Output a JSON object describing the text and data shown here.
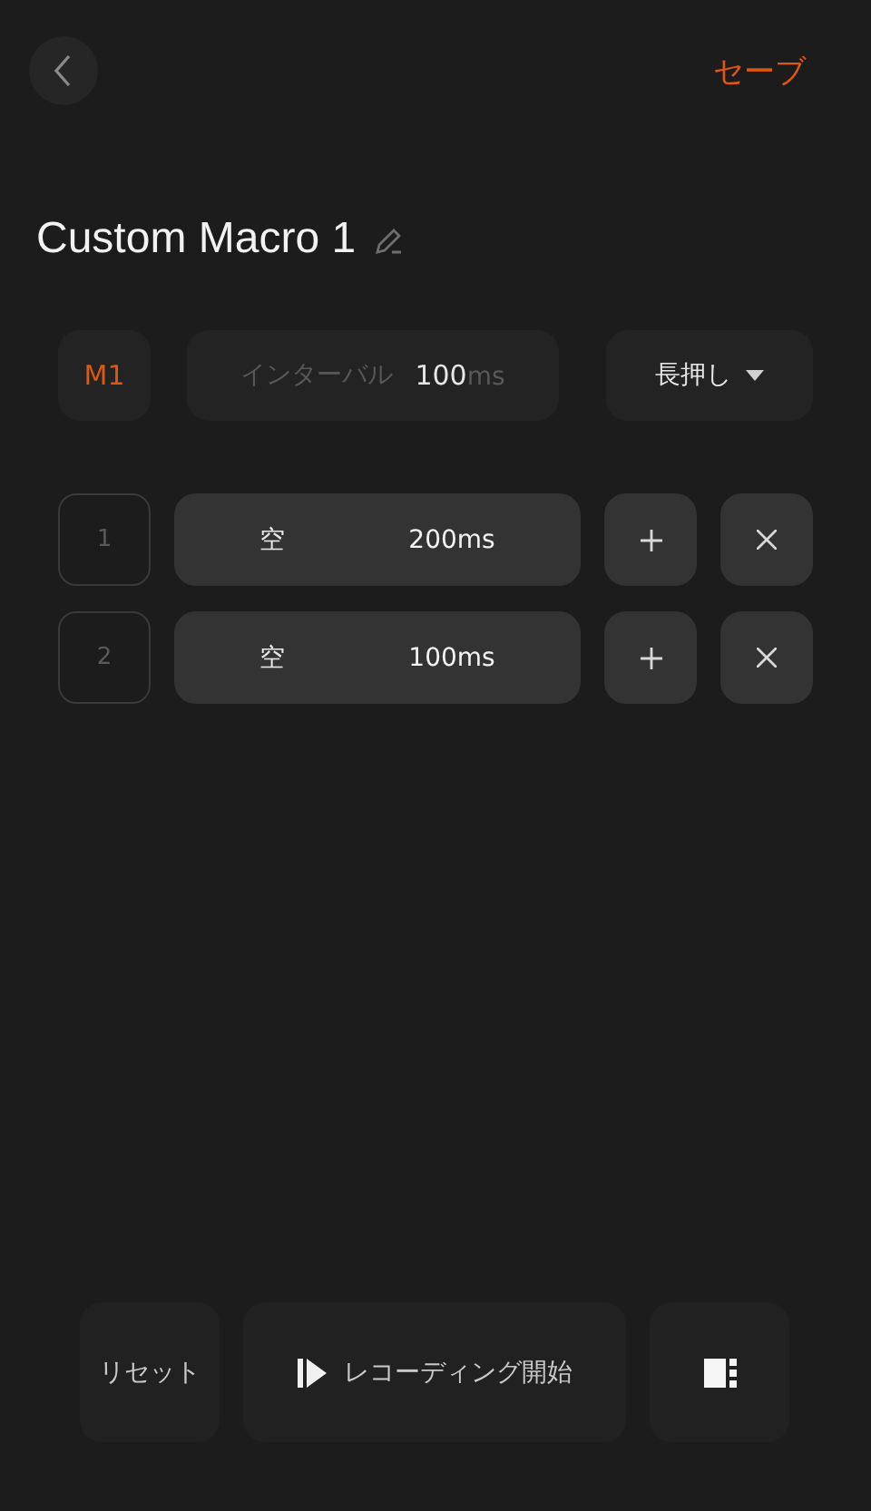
{
  "header": {
    "save": "セーブ"
  },
  "title": "Custom Macro 1",
  "settings": {
    "macro_key": "M1",
    "interval_label": "インターバル",
    "interval_value": "100",
    "interval_unit": "ms",
    "mode": "長押し"
  },
  "steps": [
    {
      "index": "1",
      "key": "空",
      "duration": "200ms"
    },
    {
      "index": "2",
      "key": "空",
      "duration": "100ms"
    }
  ],
  "footer": {
    "reset": "リセット",
    "record": "レコーディング開始"
  }
}
